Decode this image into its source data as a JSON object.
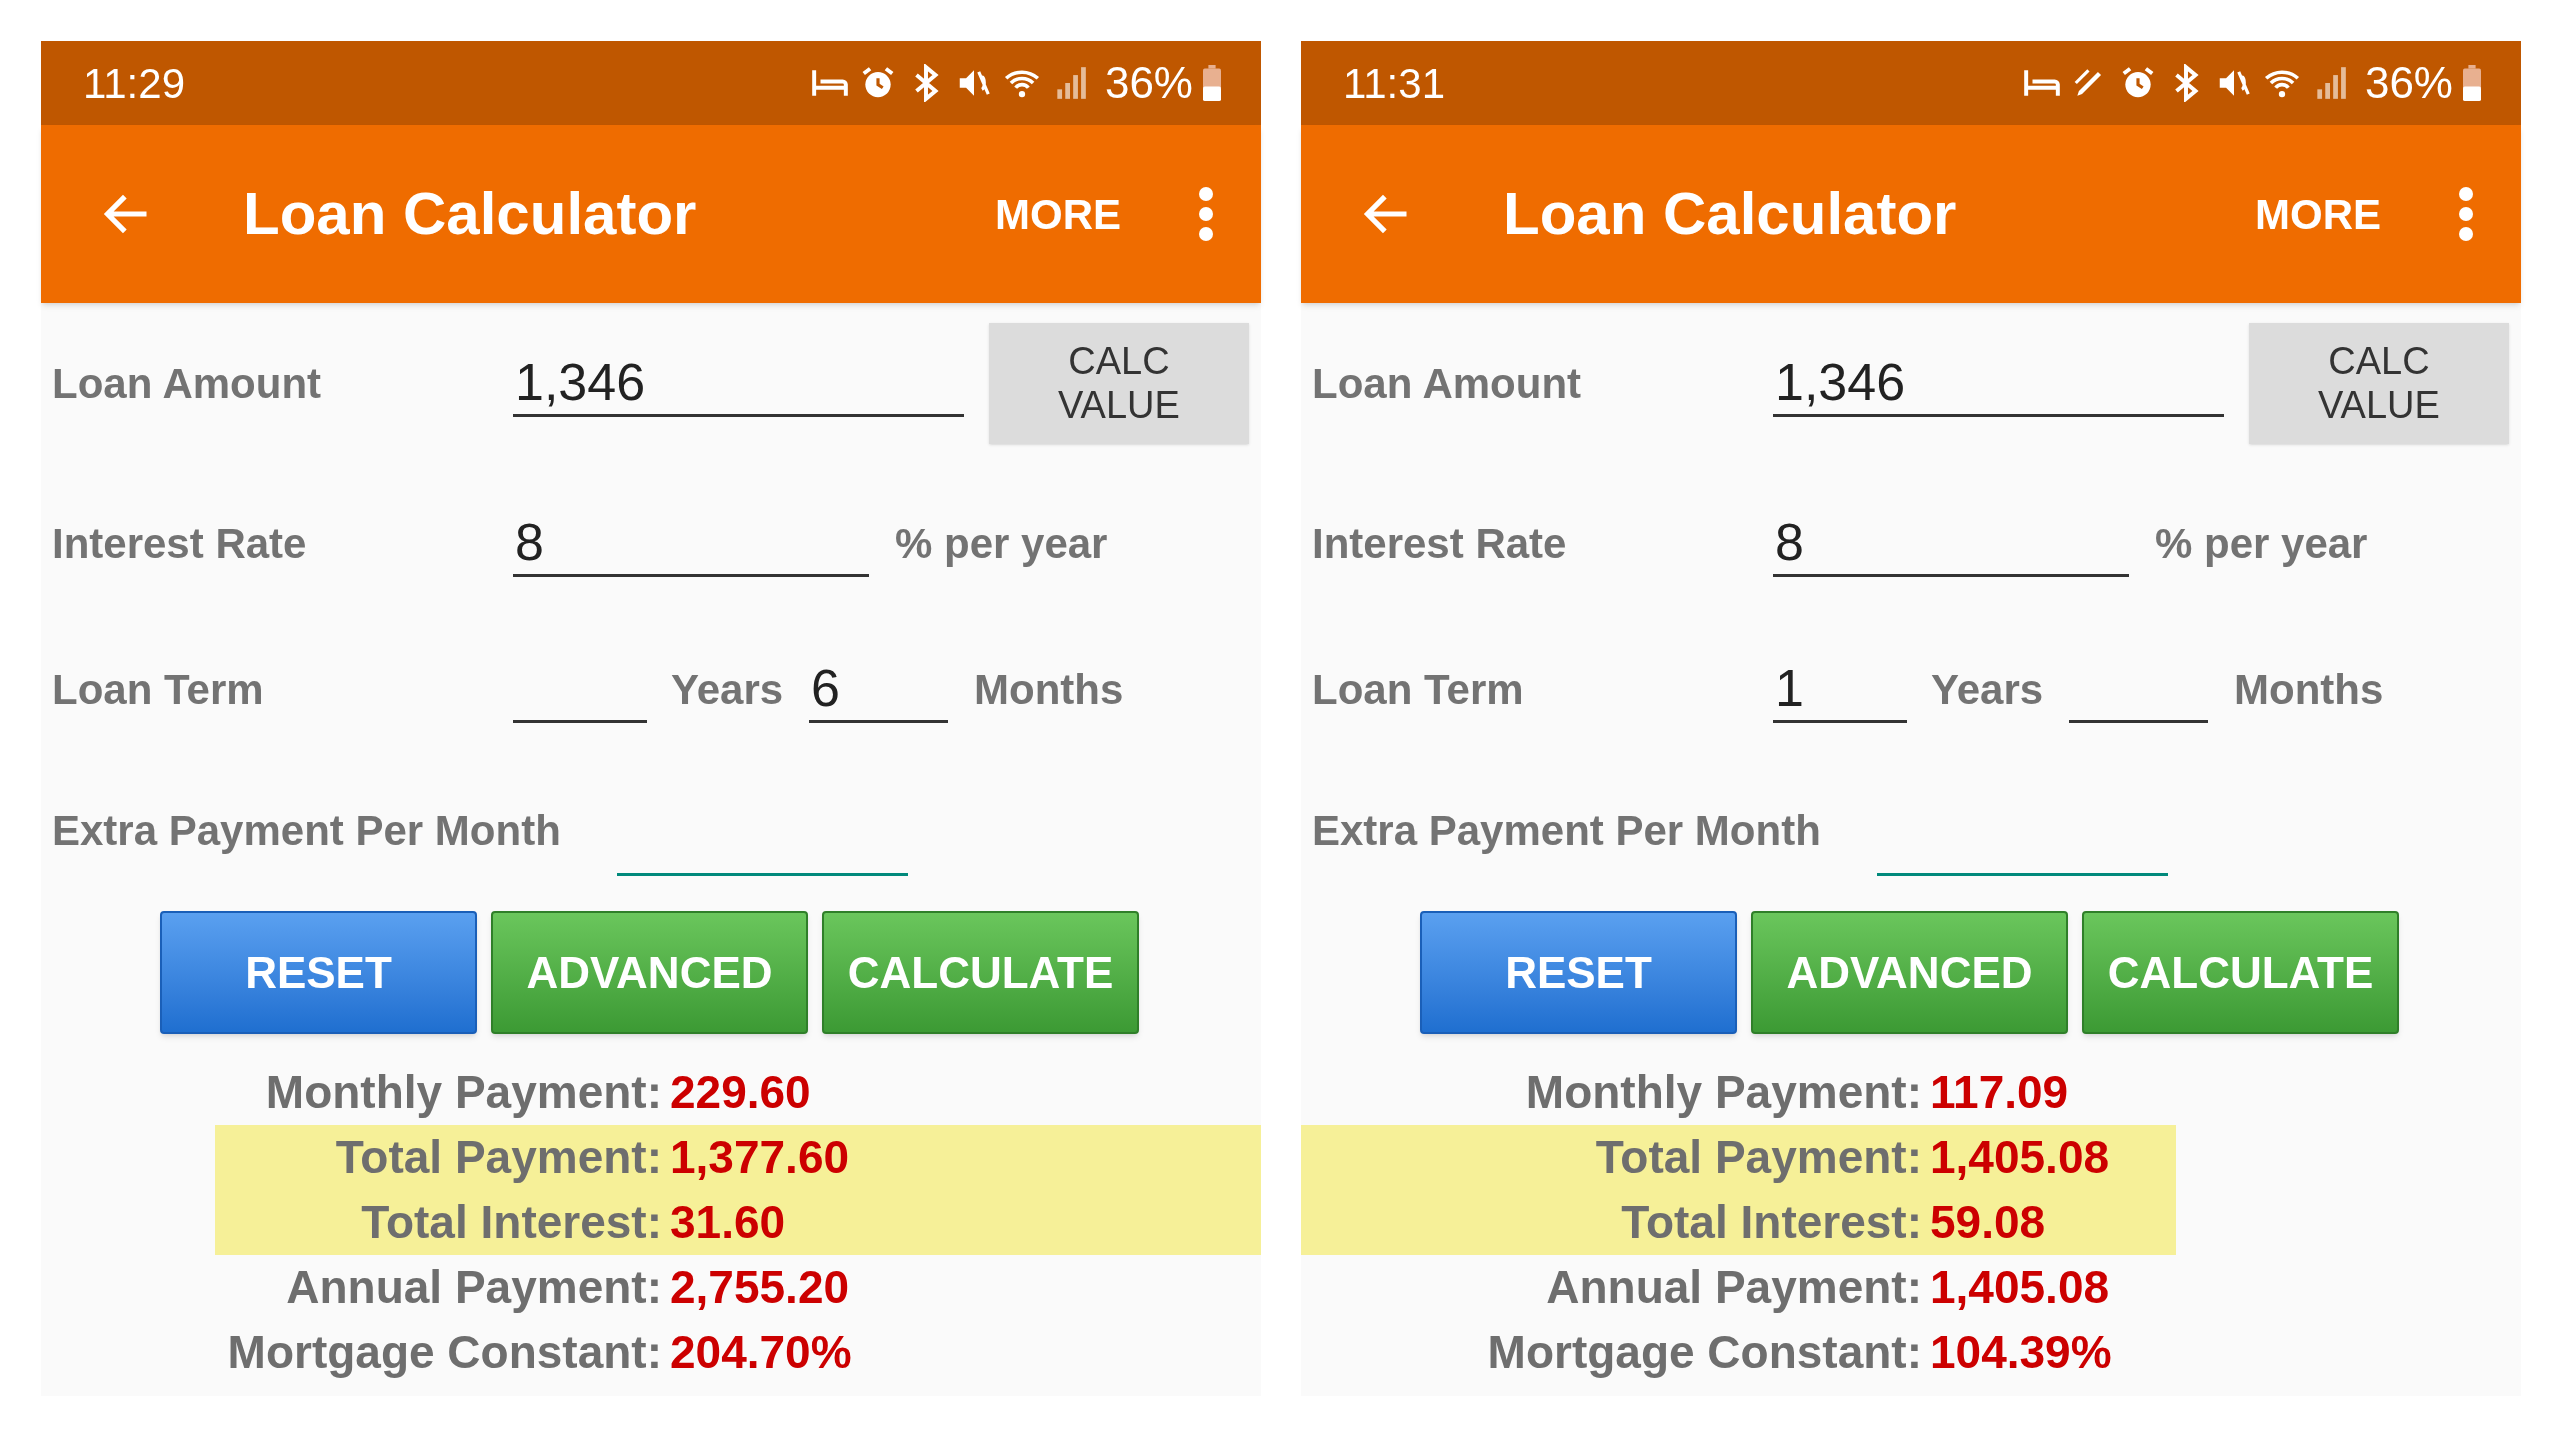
{
  "screens": [
    {
      "status_bar": {
        "time": "11:29",
        "icons": [
          {
            "kind": "bed"
          },
          {
            "kind": "alarm"
          },
          {
            "kind": "bluetooth"
          },
          {
            "kind": "mute"
          },
          {
            "kind": "wifi"
          },
          {
            "kind": "signal"
          }
        ],
        "battery": "36%"
      },
      "app_bar": {
        "title": "Loan Calculator",
        "action": "MORE"
      },
      "loan_amount": {
        "label": "Loan Amount",
        "value": "1,346",
        "button": "CALC VALUE"
      },
      "interest_rate": {
        "label": "Interest Rate",
        "value": "8",
        "unit": "% per year"
      },
      "loan_term": {
        "label": "Loan Term",
        "years_unit": "Years",
        "months_value": "6",
        "months_unit": "Months"
      },
      "extra_payment": {
        "label": "Extra Payment Per Month"
      },
      "buttons": [
        {
          "label": "RESET",
          "kind": "primary"
        },
        {
          "label": "ADVANCED",
          "kind": "success"
        },
        {
          "label": "CALCULATE",
          "kind": "success"
        }
      ],
      "results": [
        {
          "label": "Monthly Payment:",
          "value": "229.60",
          "highlighted": false
        },
        {
          "label": "Total Payment:",
          "value": "1,377.60",
          "highlighted": true
        },
        {
          "label": "Total Interest:",
          "value": "31.60",
          "highlighted": true
        },
        {
          "label": "Annual Payment:",
          "value": "2,755.20",
          "highlighted": false
        },
        {
          "label": "Mortgage Constant:",
          "value": "204.70%",
          "highlighted": false
        }
      ]
    },
    {
      "status_bar": {
        "time": "11:31",
        "icons": [
          {
            "kind": "bed"
          },
          {
            "kind": "pen"
          },
          {
            "kind": "alarm"
          },
          {
            "kind": "bluetooth"
          },
          {
            "kind": "mute"
          },
          {
            "kind": "wifi"
          },
          {
            "kind": "signal"
          }
        ],
        "battery": "36%"
      },
      "app_bar": {
        "title": "Loan Calculator",
        "action": "MORE"
      },
      "loan_amount": {
        "label": "Loan Amount",
        "value": "1,346",
        "button": "CALC VALUE"
      },
      "interest_rate": {
        "label": "Interest Rate",
        "value": "8",
        "unit": "% per year"
      },
      "loan_term": {
        "label": "Loan Term",
        "years_value": "1",
        "years_unit": "Years",
        "months_unit": "Months"
      },
      "extra_payment": {
        "label": "Extra Payment Per Month"
      },
      "buttons": [
        {
          "label": "RESET",
          "kind": "primary"
        },
        {
          "label": "ADVANCED",
          "kind": "success"
        },
        {
          "label": "CALCULATE",
          "kind": "success"
        }
      ],
      "results": [
        {
          "label": "Monthly Payment:",
          "value": "117.09",
          "highlighted": false
        },
        {
          "label": "Total Payment:",
          "value": "1,405.08",
          "highlighted": true
        },
        {
          "label": "Total Interest:",
          "value": "59.08",
          "highlighted": true
        },
        {
          "label": "Annual Payment:",
          "value": "1,405.08",
          "highlighted": false
        },
        {
          "label": "Mortgage Constant:",
          "value": "104.39%",
          "highlighted": false
        }
      ]
    }
  ]
}
